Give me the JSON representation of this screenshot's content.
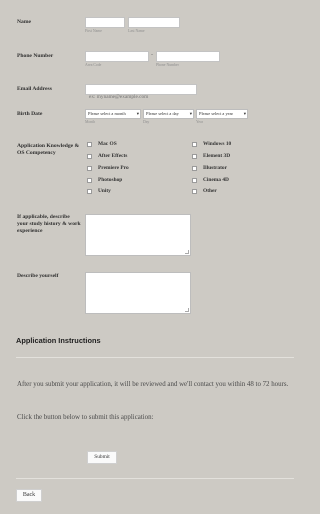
{
  "form": {
    "name": {
      "label": "Name",
      "first_name_value": "",
      "last_name_value": "",
      "first_name_sub": "First Name",
      "last_name_sub": "Last Name"
    },
    "phone": {
      "label": "Phone Number",
      "dash": "-",
      "area_code_value": "",
      "phone_value": "",
      "area_code_sub": "Area Code",
      "phone_sub": "Phone Number"
    },
    "email": {
      "label": "Email Address",
      "placeholder": "ex: myname@example.com"
    },
    "birth_date": {
      "label": "Birth Date",
      "month": {
        "selected": "Please select a month",
        "sub": "Month"
      },
      "day": {
        "selected": "Please select a day",
        "sub": "Day"
      },
      "year": {
        "selected": "Please select a year",
        "sub": "Year"
      }
    },
    "application_knowledge": {
      "label": "Application Knowledge & OS Competency",
      "left_options": [
        "Mac OS",
        "After Effects",
        "Premiere Pro",
        "Photoshop",
        "Unity"
      ],
      "right_options": [
        "Windows 10",
        "Element 3D",
        "Illustrator",
        "Cinema 4D",
        "Other"
      ]
    },
    "study_history": {
      "label": "If applicable, describe your study history & work experience",
      "value": ""
    },
    "describe_yourself": {
      "label": "Describe yourself",
      "value": ""
    }
  },
  "instructions": {
    "heading": "Application Instructions",
    "paragraph1": "After you submit your application, it will be reviewed and we'll contact you within 48 to 72 hours.",
    "paragraph2": "Click the button below to submit this application:"
  },
  "buttons": {
    "submit": "Submit",
    "back": "Back"
  }
}
